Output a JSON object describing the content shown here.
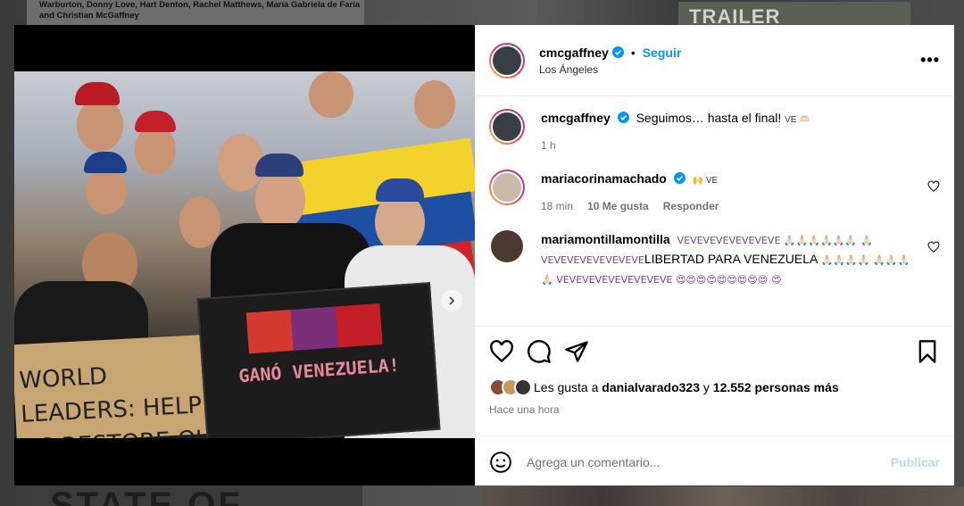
{
  "background": {
    "article_text": "Warburton, Donny Love, Hart Denton, Rachel Matthews, María Gabriela de Faría and Christian McGaffney",
    "trailer_label": "TRAILER",
    "state_label": "STATE OF"
  },
  "post": {
    "photo": {
      "sign_cardboard": "WORLD LEADERS: HELP US RESTORE OUR",
      "sign_black": "GANÓ VENEZUELA!",
      "carousel_dots": 3,
      "carousel_active": 1
    },
    "header": {
      "username": "cmcgaffney",
      "separator": "•",
      "follow_label": "Seguir",
      "location": "Los Ángeles",
      "more": "•••"
    },
    "caption": {
      "username": "cmcgaffney",
      "text": "Seguimos… hasta el final!",
      "emoji": "VE 🫶🏻",
      "time": "1 h"
    },
    "comments": [
      {
        "username": "mariacorinamachado",
        "text": "🙌 VE",
        "time": "18 min",
        "likes": "10 Me gusta",
        "reply": "Responder"
      },
      {
        "username": "mariamontillamontilla",
        "text_a": "VEVEVEVEVEVEVEVE 🙏🏻🙏🏻🙏🏻🙏🏻🙏🏻🙏🏻",
        "text_b": "🙏🏻 VEVEVEVEVEVEVEVE",
        "text_c": "LIBERTAD PARA VENEZUELA",
        "text_d": "🙏🏻🙏🏻🙏🏻🙏🏻",
        "text_e": "🙏🏻🙏🏻🙏🏻🙏🏻 VEVEVEVEVEVEVEVEVE 😍😍😍😍😍😍😍😍😍",
        "text_f": "😍"
      }
    ],
    "likes": {
      "prefix": "Les gusta a",
      "user": "danialvarado323",
      "middle": "y",
      "count": "12.552 personas más"
    },
    "time": "Hace una hora",
    "comment_box": {
      "placeholder": "Agrega un comentario...",
      "publish": "Publicar"
    },
    "colors": {
      "accent": "#0095f6",
      "publish_disabled": "#b3dbff",
      "muted": "#737373"
    }
  }
}
